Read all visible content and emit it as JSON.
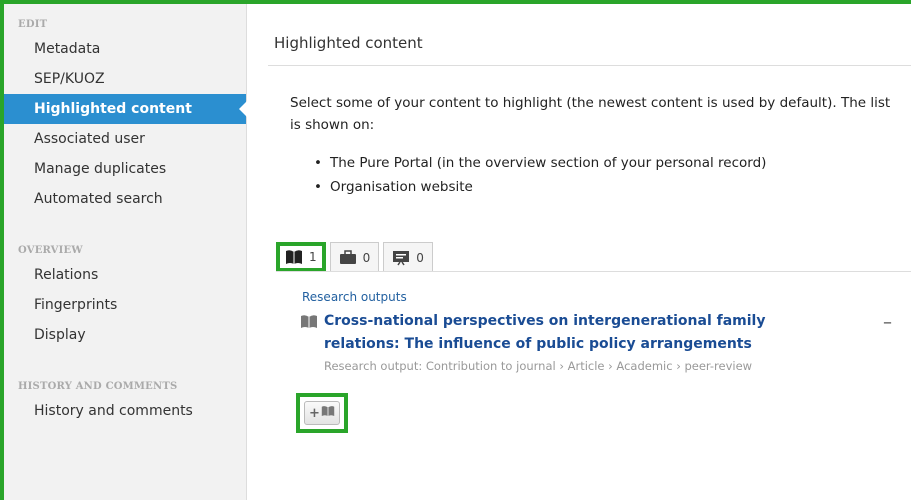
{
  "sidebar": {
    "sections": [
      {
        "heading": "EDIT",
        "items": [
          "Metadata",
          "SEP/KUOZ",
          "Highlighted content",
          "Associated user",
          "Manage duplicates",
          "Automated search"
        ]
      },
      {
        "heading": "OVERVIEW",
        "items": [
          "Relations",
          "Fingerprints",
          "Display"
        ]
      },
      {
        "heading": "HISTORY AND COMMENTS",
        "items": [
          "History and comments"
        ]
      }
    ],
    "active_item": "Highlighted content"
  },
  "main": {
    "title": "Highlighted content",
    "intro": "Select some of your content to highlight (the newest content is used by default). The list is shown on:",
    "bullets": [
      "The Pure Portal (in the overview section of your personal record)",
      "Organisation website"
    ],
    "tabs": [
      {
        "icon": "book-icon",
        "count": "1",
        "active": true
      },
      {
        "icon": "briefcase-icon",
        "count": "0",
        "active": false
      },
      {
        "icon": "presentation-icon",
        "count": "0",
        "active": false
      }
    ],
    "section_label": "Research outputs",
    "output": {
      "title": "Cross-national perspectives on intergenerational family relations: The influence of public policy arrangements",
      "meta": "Research output: Contribution to journal › Article › Academic › peer-review",
      "remove_label": "–"
    },
    "add_button_label": "+"
  },
  "colors": {
    "accent": "#2b8fd0",
    "highlight": "#2aa52a",
    "link": "#1a4c94"
  }
}
